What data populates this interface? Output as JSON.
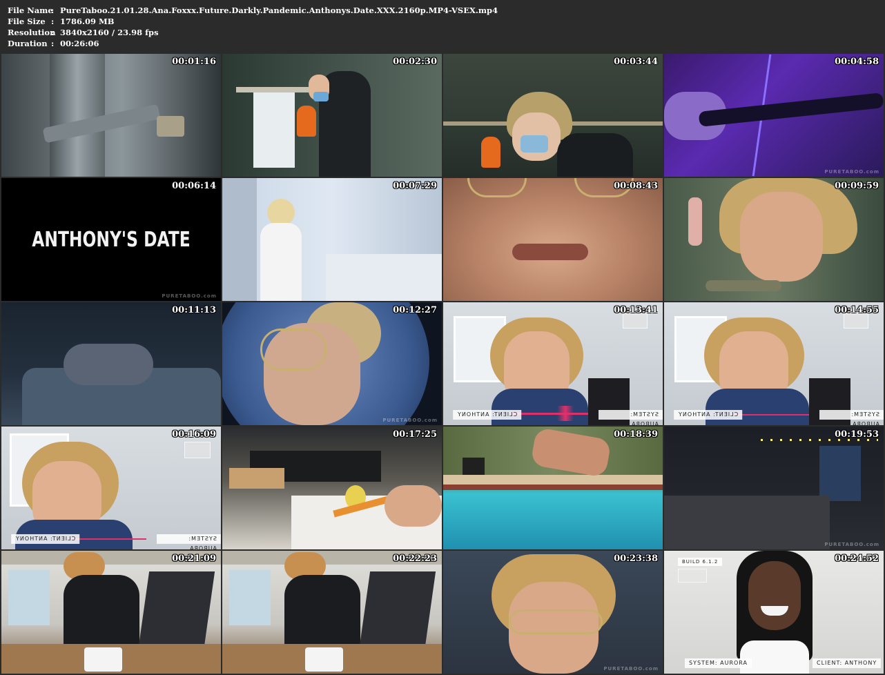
{
  "file_info": {
    "name_label": "File Name",
    "name_value": "PureTaboo.21.01.28.Ana.Foxxx.Future.Darkly.Pandemic.Anthonys.Date.XXX.2160p.MP4-VSEX.mp4",
    "size_label": "File Size",
    "size_value": "1786.09 MB",
    "resolution_label": "Resolution",
    "resolution_value": "3840x2160 / 23.98 fps",
    "duration_label": "Duration",
    "duration_value": "00:26:06",
    "colon": ":"
  },
  "thumbnails": [
    {
      "time": "00:01:16"
    },
    {
      "time": "00:02:30"
    },
    {
      "time": "00:03:44"
    },
    {
      "time": "00:04:58"
    },
    {
      "time": "00:06:14",
      "title_text": "ANTHONY'S DATE"
    },
    {
      "time": "00:07:29"
    },
    {
      "time": "00:08:43"
    },
    {
      "time": "00:09:59"
    },
    {
      "time": "00:11:13"
    },
    {
      "time": "00:12:27"
    },
    {
      "time": "00:13:41",
      "client_label": "CLIENT: ANTHONY",
      "system_label": "SYSTEM: AURORA"
    },
    {
      "time": "00:14:55",
      "client_label": "CLIENT: ANTHONY",
      "system_label": "SYSTEM: AURORA"
    },
    {
      "time": "00:16:09",
      "client_label": "CLIENT: ANTHONY",
      "system_label": "SYSTEM: AURORA"
    },
    {
      "time": "00:17:25"
    },
    {
      "time": "00:18:39"
    },
    {
      "time": "00:19:53"
    },
    {
      "time": "00:21:09"
    },
    {
      "time": "00:22:23"
    },
    {
      "time": "00:23:38"
    },
    {
      "time": "00:24:52",
      "build_label": "BUILD 6.1.2",
      "system_label": "SYSTEM: AURORA",
      "client_label": "CLIENT: ANTHONY"
    }
  ],
  "watermark_text": "PURETABOO.com",
  "colors": {
    "background": "#2b2b2b",
    "text": "#ffffff",
    "waveform": "#e0306a"
  }
}
